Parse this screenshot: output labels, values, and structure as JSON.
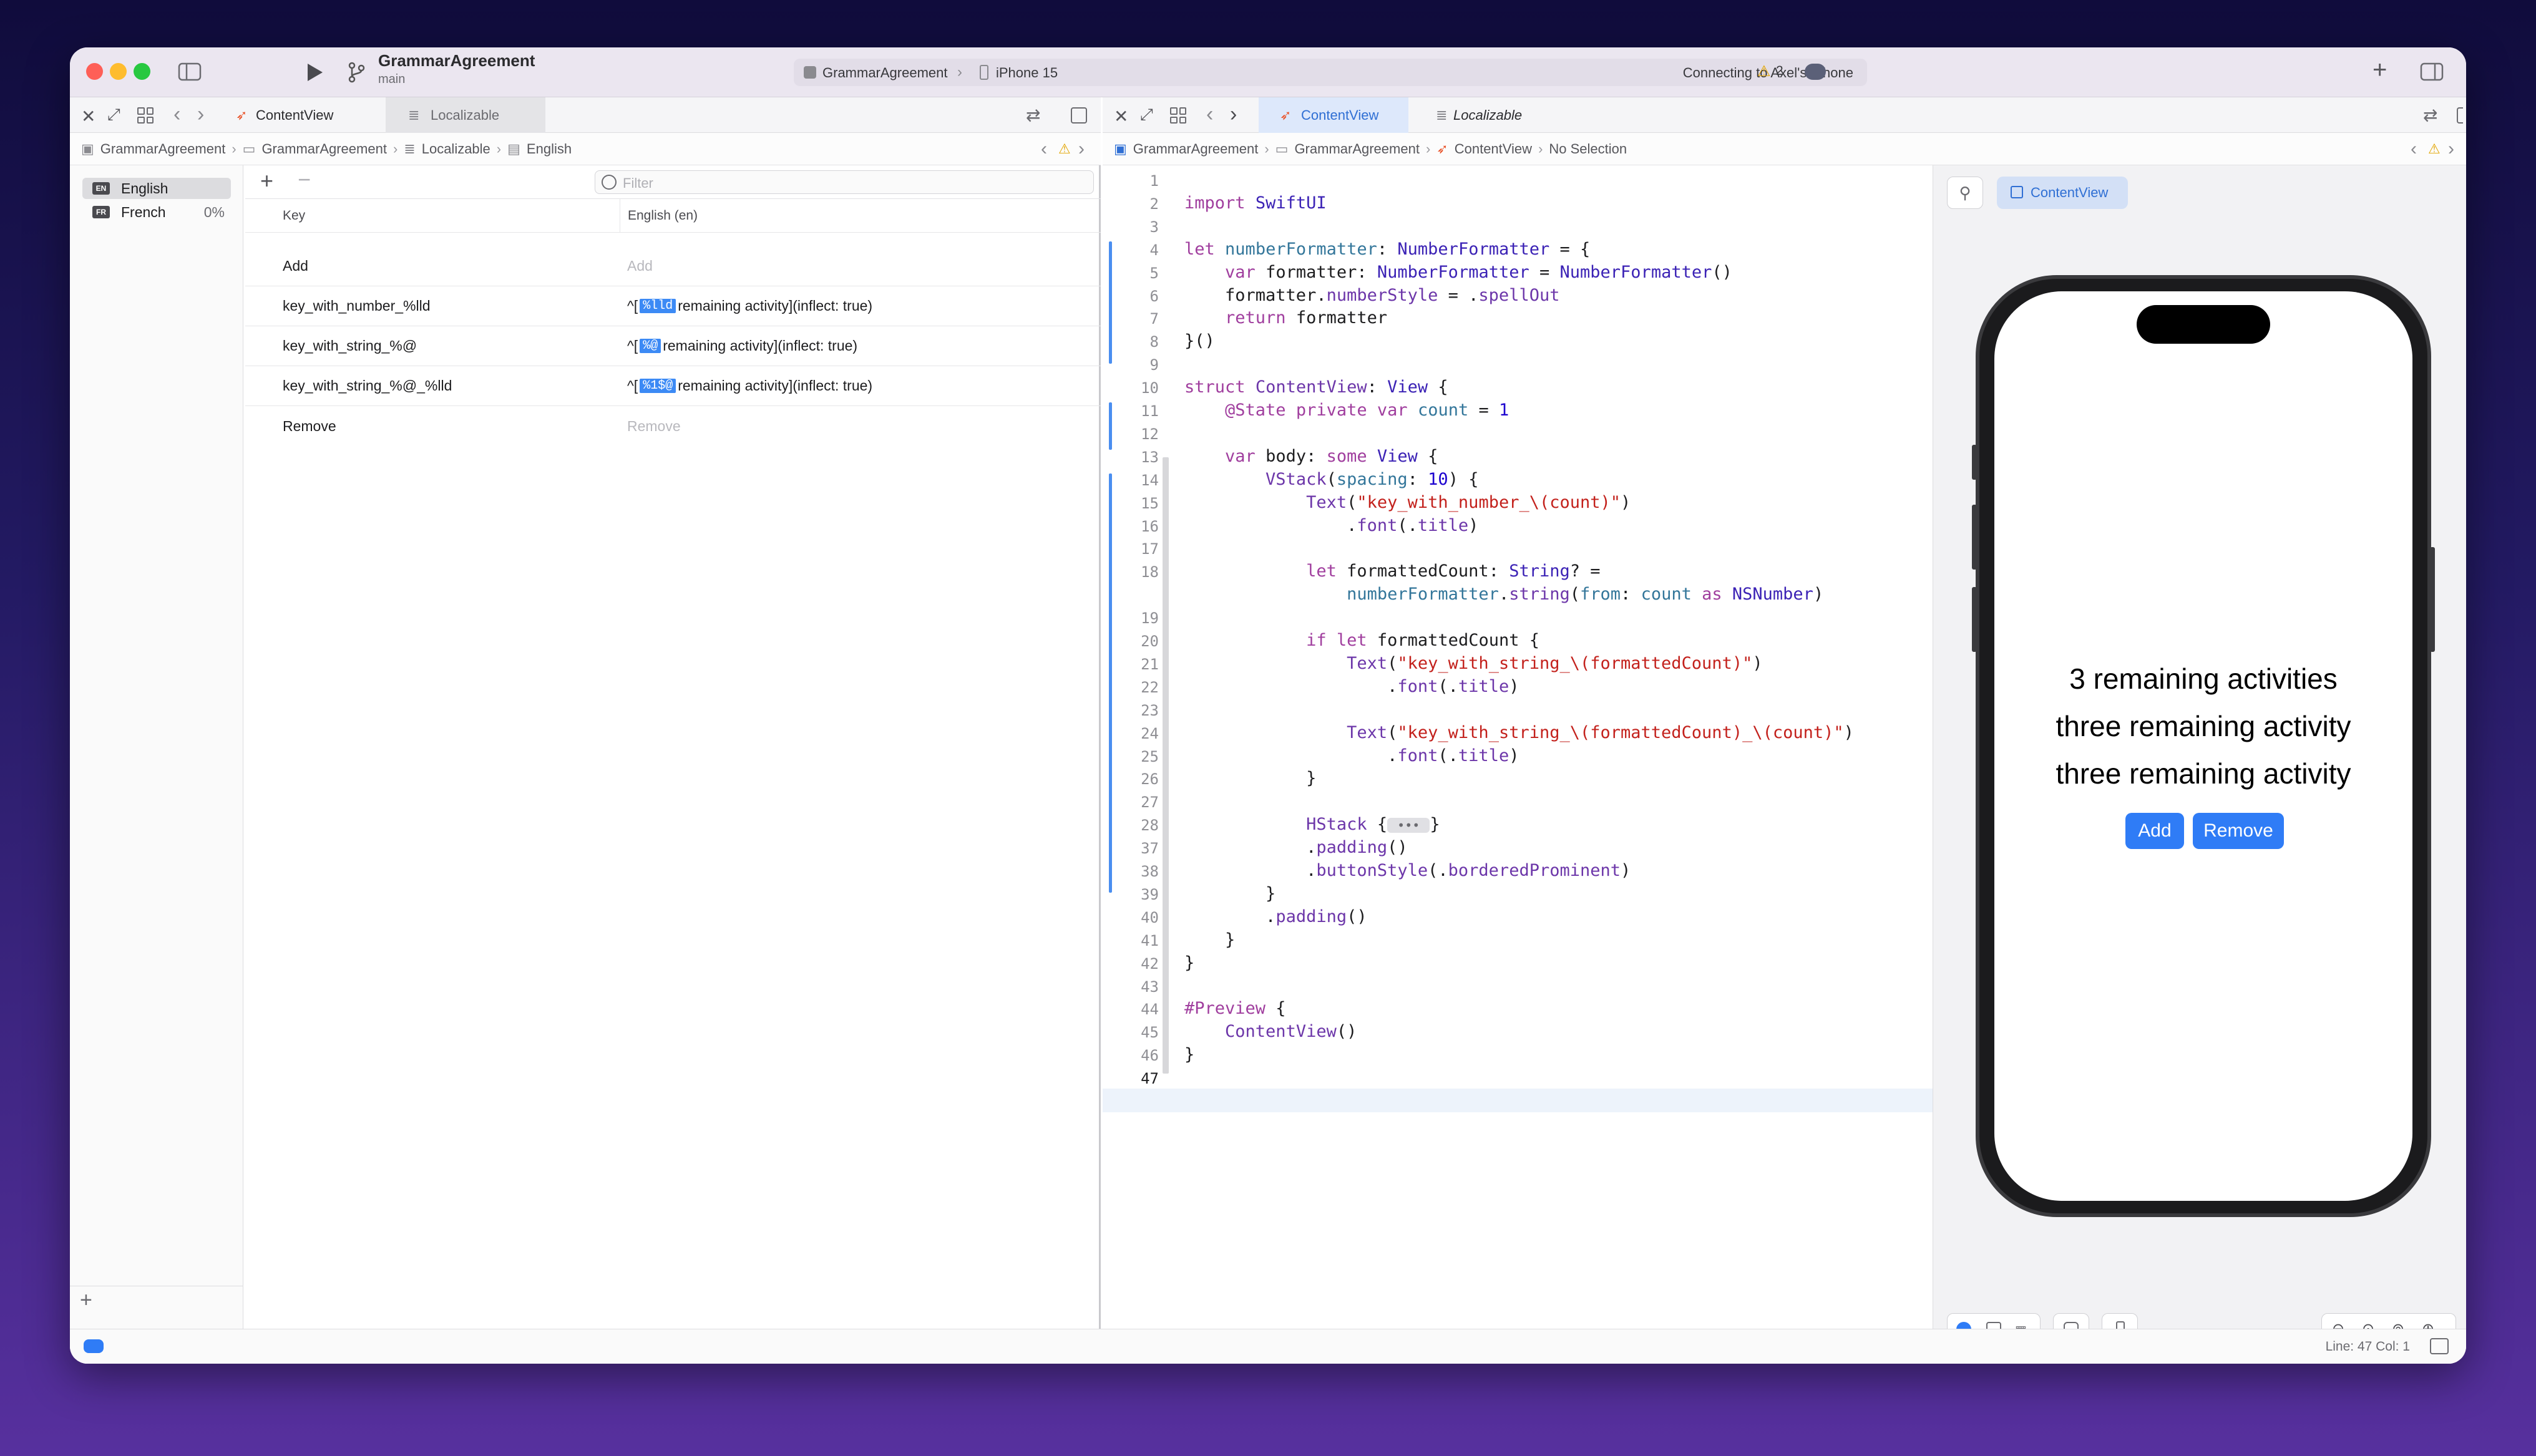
{
  "window": {
    "project": "GrammarAgreement",
    "branch": "main",
    "scheme": "GrammarAgreement",
    "device": "iPhone 15",
    "status": "Connecting to Axel's iPhone",
    "warnings": "2"
  },
  "left_pane": {
    "tabs": [
      "ContentView",
      "Localizable"
    ],
    "breadcrumb": [
      "GrammarAgreement",
      "GrammarAgreement",
      "Localizable",
      "English"
    ],
    "languages": [
      {
        "code": "EN",
        "name": "English",
        "pct": ""
      },
      {
        "code": "FR",
        "name": "French",
        "pct": "0%"
      }
    ],
    "filter_placeholder": "Filter",
    "columns": [
      "Key",
      "English (en)"
    ],
    "rows": [
      {
        "key": "Add",
        "value": "Add",
        "dim": true
      },
      {
        "key": "key_with_number_%lld",
        "pre": "^[",
        "token": "%lld",
        "post": "remaining activity](inflect: true)"
      },
      {
        "key": "key_with_string_%@",
        "pre": "^[",
        "token": "%@",
        "post": "remaining activity](inflect: true)"
      },
      {
        "key": "key_with_string_%@_%lld",
        "pre": "^[",
        "token": "%1$@",
        "post": "remaining activity](inflect: true)"
      },
      {
        "key": "Remove",
        "value": "Remove",
        "dim": true
      }
    ]
  },
  "right_pane": {
    "tabs": [
      "ContentView",
      "Localizable"
    ],
    "breadcrumb": [
      "GrammarAgreement",
      "GrammarAgreement",
      "ContentView",
      "No Selection"
    ],
    "line_numbers": [
      "1",
      "2",
      "3",
      "4",
      "5",
      "6",
      "7",
      "8",
      "9",
      "10",
      "11",
      "12",
      "13",
      "14",
      "15",
      "16",
      "17",
      "18",
      "",
      "19",
      "20",
      "21",
      "22",
      "23",
      "24",
      "25",
      "26",
      "27",
      "28",
      "37",
      "38",
      "39",
      "40",
      "41",
      "42",
      "43",
      "44",
      "45",
      "46",
      "47"
    ],
    "code": [
      "",
      "import SwiftUI",
      "",
      "let numberFormatter: NumberFormatter = {",
      "    var formatter: NumberFormatter = NumberFormatter()",
      "    formatter.numberStyle = .spellOut",
      "    return formatter",
      "}()",
      "",
      "struct ContentView: View {",
      "    @State private var count = 1",
      "",
      "    var body: some View {",
      "        VStack(spacing: 10) {",
      "            Text(\"key_with_number_\\(count)\")",
      "                .font(.title)",
      "",
      "            let formattedCount: String? =",
      "                numberFormatter.string(from: count as NSNumber)",
      "",
      "            if let formattedCount {",
      "                Text(\"key_with_string_\\(formattedCount)\")",
      "                    .font(.title)",
      "",
      "                Text(\"key_with_string_\\(formattedCount)_\\(count)\")",
      "                    .font(.title)",
      "            }",
      "",
      "            HStack {",
      "            .padding()",
      "            .buttonStyle(.borderedProminent)",
      "        }",
      "        .padding()",
      "    }",
      "}",
      "",
      "#Preview {",
      "    ContentView()",
      "}",
      ""
    ],
    "fold_marker": "•••",
    "preview": {
      "pin_label": "ContentView",
      "lines": [
        "3 remaining activities",
        "three remaining activity",
        "three remaining activity"
      ],
      "buttons": [
        "Add",
        "Remove"
      ]
    }
  },
  "statusbar": {
    "position": "Line: 47  Col: 1"
  }
}
